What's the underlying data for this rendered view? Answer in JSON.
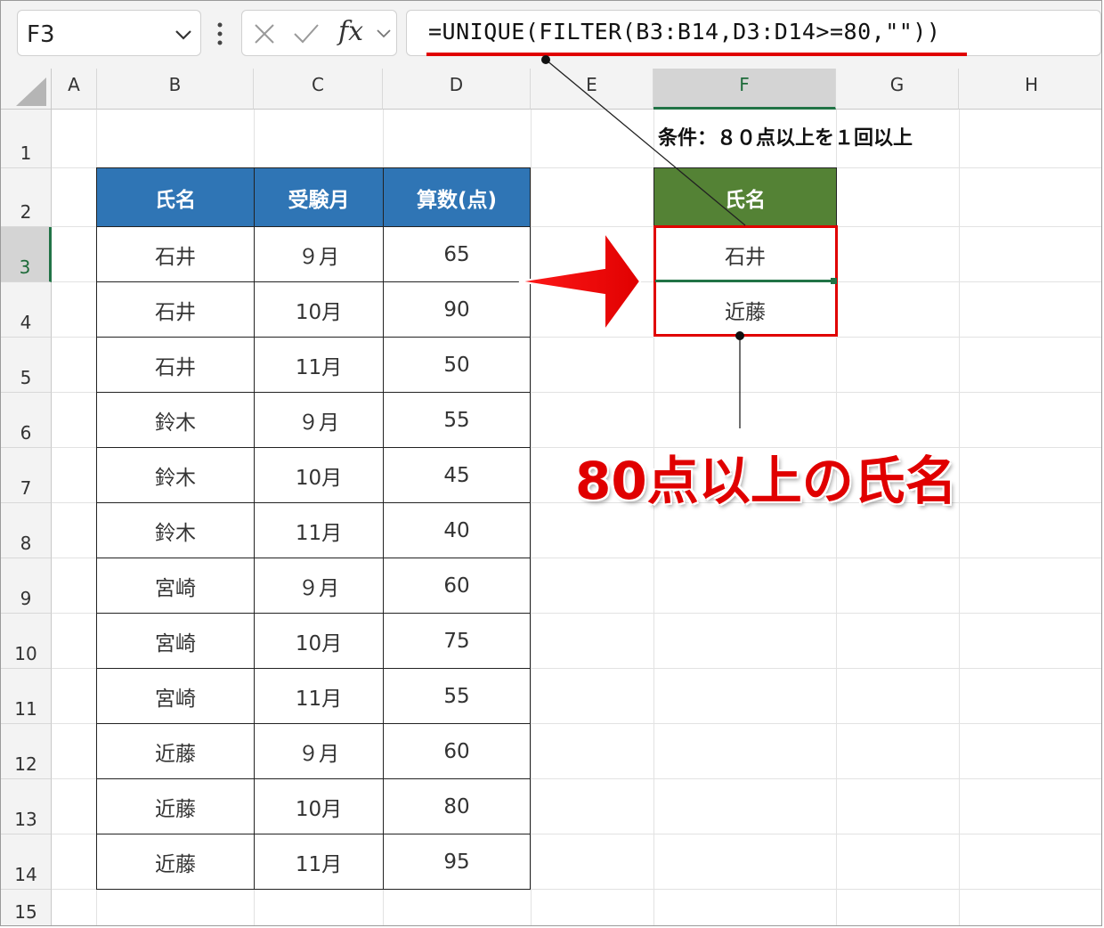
{
  "formula_bar": {
    "name_box": "F3",
    "fx_label": "fx",
    "formula": "=UNIQUE(FILTER(B3:B14,D3:D14>=80,\"\"))"
  },
  "columns": [
    "A",
    "B",
    "C",
    "D",
    "E",
    "F",
    "G",
    "H"
  ],
  "rows": [
    "1",
    "2",
    "3",
    "4",
    "5",
    "6",
    "7",
    "8",
    "9",
    "10",
    "11",
    "12",
    "13",
    "14",
    "15"
  ],
  "active_cell": "F3",
  "source_table": {
    "headers": [
      "氏名",
      "受験月",
      "算数(点)"
    ],
    "rows": [
      [
        "石井",
        "９月",
        "65"
      ],
      [
        "石井",
        "10月",
        "90"
      ],
      [
        "石井",
        "11月",
        "50"
      ],
      [
        "鈴木",
        "９月",
        "55"
      ],
      [
        "鈴木",
        "10月",
        "45"
      ],
      [
        "鈴木",
        "11月",
        "40"
      ],
      [
        "宮崎",
        "９月",
        "60"
      ],
      [
        "宮崎",
        "10月",
        "75"
      ],
      [
        "宮崎",
        "11月",
        "55"
      ],
      [
        "近藤",
        "９月",
        "60"
      ],
      [
        "近藤",
        "10月",
        "80"
      ],
      [
        "近藤",
        "11月",
        "95"
      ]
    ]
  },
  "condition_text": "条件：８０点以上を１回以上",
  "result_table": {
    "header": "氏名",
    "values": [
      "石井",
      "近藤"
    ]
  },
  "annotation": "80点以上の氏名",
  "colors": {
    "source_header": "#2f75b5",
    "result_header": "#548235",
    "highlight_red": "#e00000",
    "excel_green": "#217346"
  }
}
